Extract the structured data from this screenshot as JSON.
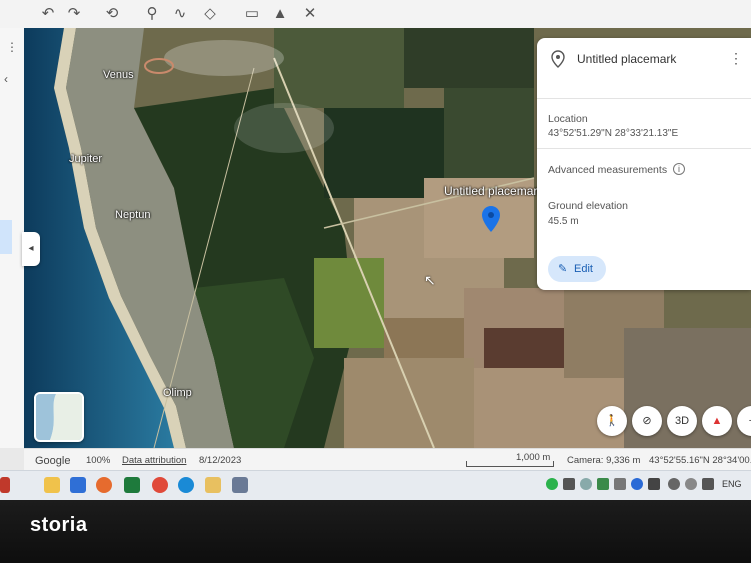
{
  "map": {
    "labels": {
      "venus": "Venus",
      "jupiter": "Jupiter",
      "neptun": "Neptun",
      "olimp": "Olimp",
      "placemark": "Untitled placemark"
    }
  },
  "panel": {
    "title": "Untitled placemark",
    "location_label": "Location",
    "location_value": "43°52'51.29\"N 28°33'21.13\"E",
    "advanced_label": "Advanced measurements",
    "elevation_label": "Ground elevation",
    "elevation_value": "45.5 m",
    "edit_label": "Edit"
  },
  "controls": {
    "three_d": "3D"
  },
  "status": {
    "google": "Google",
    "zoom": "100%",
    "attribution": "Data attribution",
    "date": "8/12/2023",
    "scale": "1,000 m",
    "camera": "Camera: 9,336 m",
    "coords": "43°52'55.16\"N 28°34'00.0"
  },
  "taskbar": {
    "lang": "ENG"
  },
  "watermark": {
    "text": "storia"
  },
  "colors": {
    "accent": "#1a73e8",
    "edit_bg": "#d6e7fb"
  }
}
